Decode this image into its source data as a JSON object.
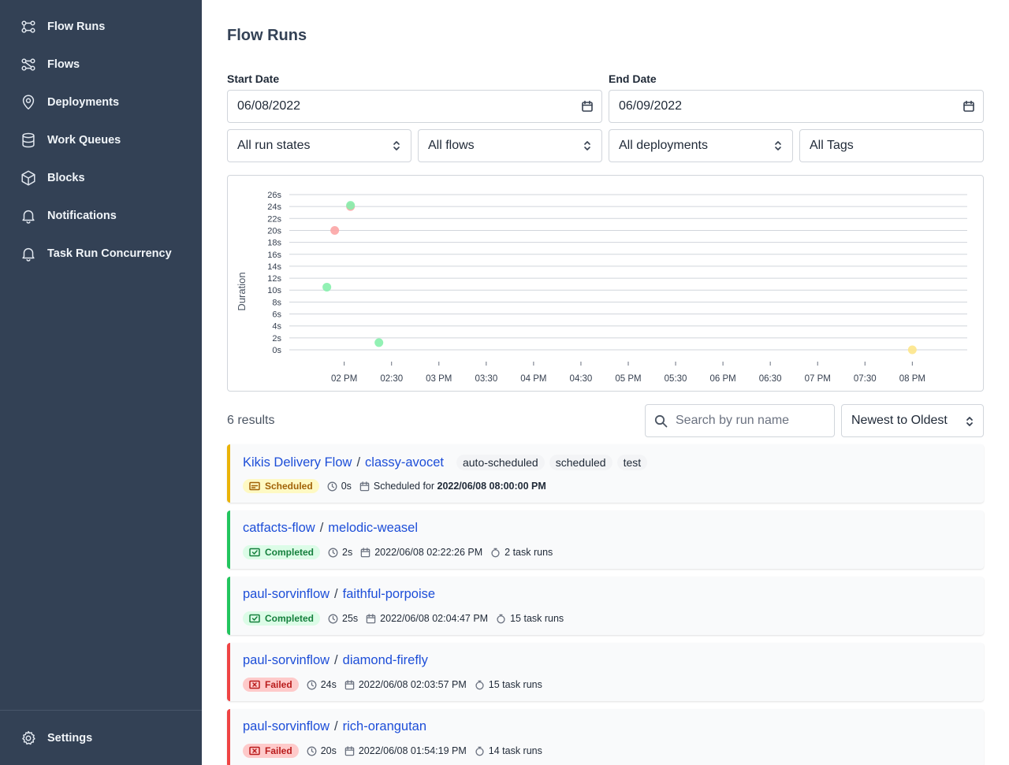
{
  "sidebar": {
    "items": [
      {
        "label": "Flow Runs",
        "icon": "flow-runs-icon"
      },
      {
        "label": "Flows",
        "icon": "flows-icon"
      },
      {
        "label": "Deployments",
        "icon": "map-pin-icon"
      },
      {
        "label": "Work Queues",
        "icon": "database-icon"
      },
      {
        "label": "Blocks",
        "icon": "cube-icon"
      },
      {
        "label": "Notifications",
        "icon": "bell-icon"
      },
      {
        "label": "Task Run Concurrency",
        "icon": "bell-icon"
      }
    ],
    "settings_label": "Settings"
  },
  "page": {
    "title": "Flow Runs"
  },
  "filters": {
    "start_date_label": "Start Date",
    "start_date_value": "06/08/2022",
    "end_date_label": "End Date",
    "end_date_value": "06/09/2022",
    "run_states": "All run states",
    "flows": "All flows",
    "deployments": "All deployments",
    "tags": "All Tags"
  },
  "chart_data": {
    "type": "scatter",
    "ylabel": "Duration",
    "y_ticks": [
      "0s",
      "2s",
      "4s",
      "6s",
      "8s",
      "10s",
      "12s",
      "14s",
      "16s",
      "18s",
      "20s",
      "22s",
      "24s",
      "26s"
    ],
    "ylim": [
      0,
      26
    ],
    "x_ticks": [
      "02 PM",
      "02:30",
      "03 PM",
      "03:30",
      "04 PM",
      "04:30",
      "05 PM",
      "05:30",
      "06 PM",
      "06:30",
      "07 PM",
      "07:30",
      "08 PM"
    ],
    "xlim_hours": [
      13.42,
      20.58
    ],
    "grid": true,
    "points": [
      {
        "x": "01:54",
        "y": 20,
        "state": "Failed"
      },
      {
        "x": "02:04",
        "y": 24,
        "state": "Failed"
      },
      {
        "x": "02:04",
        "y": 24.2,
        "state": "Completed"
      },
      {
        "x": "01:49",
        "y": 10.5,
        "state": "Completed"
      },
      {
        "x": "02:22",
        "y": 1.2,
        "state": "Completed"
      },
      {
        "x": "08:00",
        "y": 0,
        "state": "Scheduled"
      }
    ],
    "state_colors": {
      "Completed": "#86efac",
      "Failed": "#fca5a5",
      "Scheduled": "#fde68a"
    }
  },
  "results": {
    "count_text": "6 results",
    "search_placeholder": "Search by run name",
    "sort_value": "Newest to Oldest"
  },
  "runs": [
    {
      "flow": "Kikis Delivery Flow",
      "name": "classy-avocet",
      "tags": [
        "auto-scheduled",
        "scheduled",
        "test"
      ],
      "state": "Scheduled",
      "state_color": "#eab308",
      "duration": "0s",
      "time_prefix": "Scheduled for ",
      "time": "2022/06/08 08:00:00 PM",
      "task_runs": ""
    },
    {
      "flow": "catfacts-flow",
      "name": "melodic-weasel",
      "tags": [],
      "state": "Completed",
      "state_color": "#22c55e",
      "duration": "2s",
      "time_prefix": "",
      "time": "2022/06/08 02:22:26 PM",
      "task_runs": "2 task runs"
    },
    {
      "flow": "paul-sorvinflow",
      "name": "faithful-porpoise",
      "tags": [],
      "state": "Completed",
      "state_color": "#22c55e",
      "duration": "25s",
      "time_prefix": "",
      "time": "2022/06/08 02:04:47 PM",
      "task_runs": "15 task runs"
    },
    {
      "flow": "paul-sorvinflow",
      "name": "diamond-firefly",
      "tags": [],
      "state": "Failed",
      "state_color": "#ef4444",
      "duration": "24s",
      "time_prefix": "",
      "time": "2022/06/08 02:03:57 PM",
      "task_runs": "15 task runs"
    },
    {
      "flow": "paul-sorvinflow",
      "name": "rich-orangutan",
      "tags": [],
      "state": "Failed",
      "state_color": "#ef4444",
      "duration": "20s",
      "time_prefix": "",
      "time": "2022/06/08 01:54:19 PM",
      "task_runs": "14 task runs"
    }
  ]
}
